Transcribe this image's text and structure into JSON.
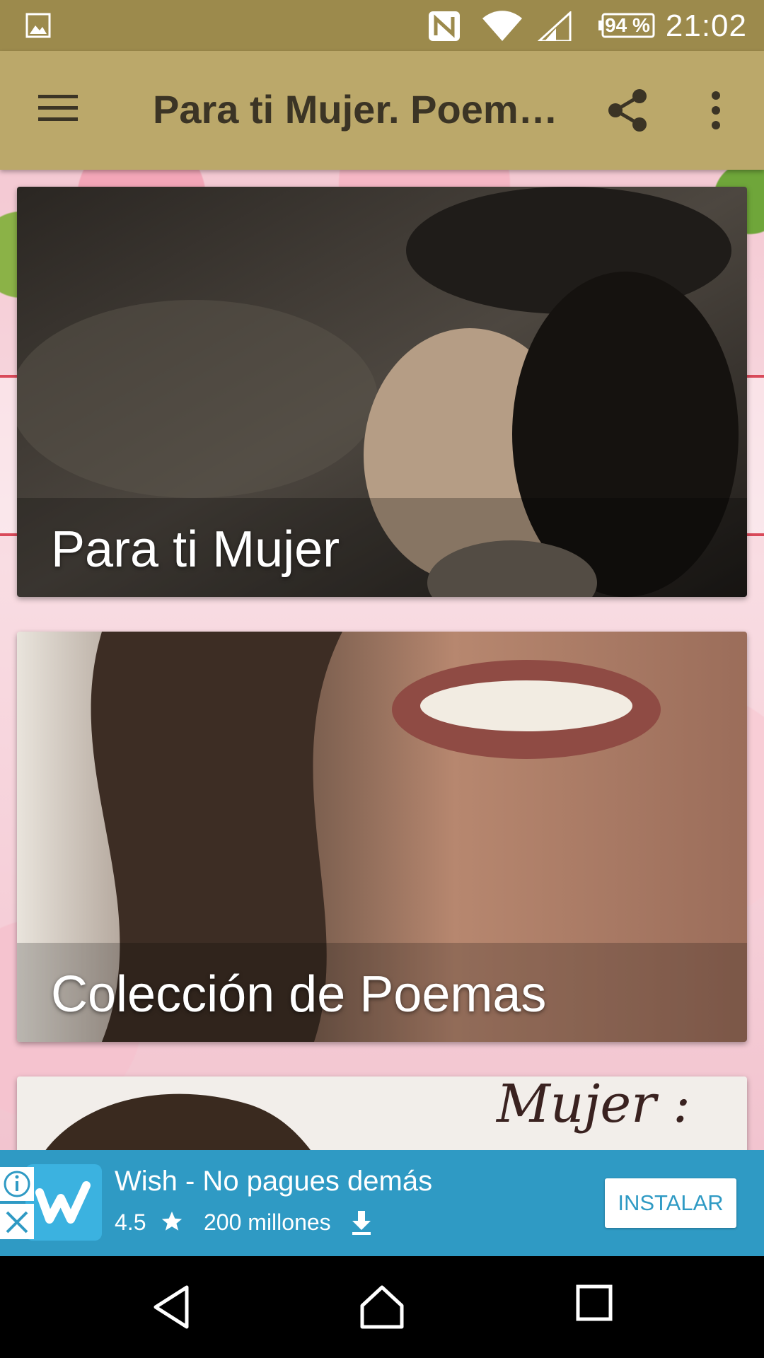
{
  "status_bar": {
    "battery": "94 %",
    "time": "21:02",
    "icons": [
      "gallery-icon",
      "nfc-icon",
      "wifi-icon",
      "signal-icon",
      "battery-icon"
    ]
  },
  "app_bar": {
    "title": "Para ti Mujer. Poem…",
    "icons": [
      "menu-icon",
      "share-icon",
      "more-vert-icon"
    ]
  },
  "cards": [
    {
      "label": "Para ti Mujer"
    },
    {
      "label": "Colección de Poemas"
    },
    {
      "label": "",
      "script_text": "Mujer :"
    }
  ],
  "ad": {
    "title": "Wish - No pagues demás",
    "rating": "4.5",
    "downloads": "200 millones",
    "install_label": "INSTALAR",
    "icons": [
      "ad-info-icon",
      "ad-close-icon",
      "star-icon",
      "download-icon"
    ]
  },
  "nav_bar": {
    "icons": [
      "back-icon",
      "home-icon",
      "recents-icon"
    ]
  },
  "colors": {
    "status_bar": "#9c8a4c",
    "app_bar": "#bba86a",
    "title_text": "#3b3425",
    "ad_background": "#2f9ac4"
  }
}
